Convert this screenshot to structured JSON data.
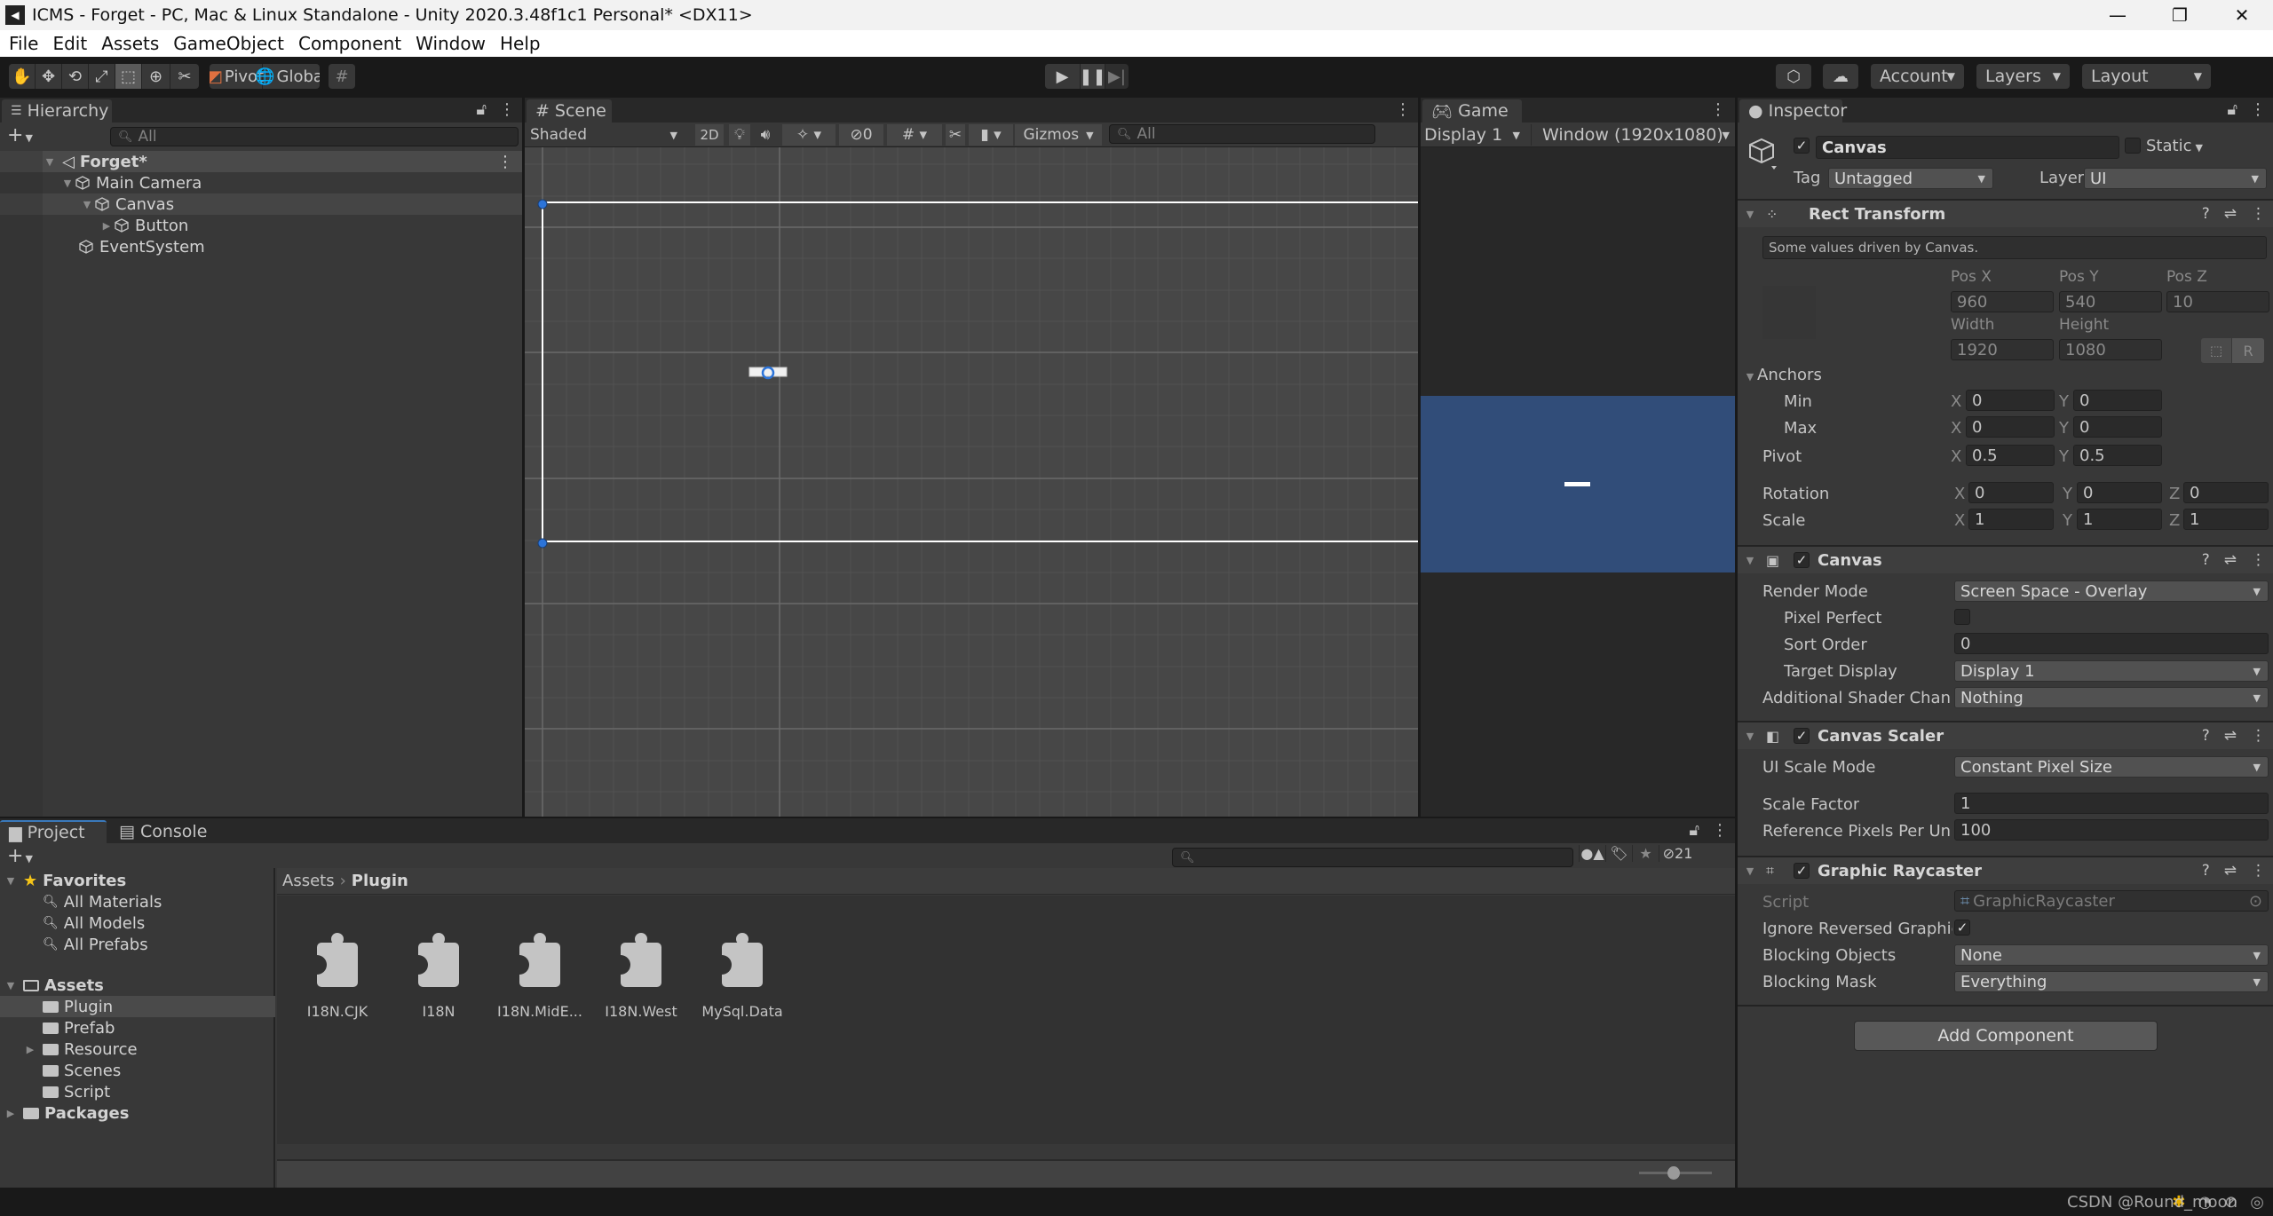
{
  "window": {
    "title": "ICMS - Forget - PC, Mac & Linux Standalone - Unity 2020.3.48f1c1 Personal* <DX11>",
    "controls": {
      "minimize": "—",
      "maximize": "❐",
      "close": "✕"
    }
  },
  "menu": [
    "File",
    "Edit",
    "Assets",
    "GameObject",
    "Component",
    "Window",
    "Help"
  ],
  "toolbar": {
    "tools": [
      "hand-tool",
      "move-tool",
      "rotate-tool",
      "scale-tool",
      "rect-tool",
      "transform-tool",
      "custom-tool"
    ],
    "active_tool": "rect-tool",
    "pivot_label": "Pivot",
    "global_label": "Global",
    "account_label": "Account",
    "layers_label": "Layers",
    "layout_label": "Layout"
  },
  "hierarchy": {
    "tab_label": "Hierarchy",
    "search_placeholder": "All",
    "scene_name": "Forget*",
    "items": [
      {
        "label": "Main Camera",
        "depth": 1,
        "expanded": true
      },
      {
        "label": "Canvas",
        "depth": 2,
        "expanded": true,
        "selected": true
      },
      {
        "label": "Button",
        "depth": 3,
        "expanded": false
      },
      {
        "label": "EventSystem",
        "depth": 1
      }
    ]
  },
  "scene": {
    "tab_label": "Scene",
    "shading_mode": "Shaded",
    "mode_2d": "2D",
    "hidden_count": "0",
    "gizmos_label": "Gizmos",
    "search_placeholder": "All"
  },
  "game": {
    "tab_label": "Game",
    "display": "Display 1",
    "resolution": "Window (1920x1080)",
    "background_color": "#314d79"
  },
  "inspector": {
    "tab_label": "Inspector",
    "object_name": "Canvas",
    "active": true,
    "static_label": "Static",
    "tag_label": "Tag",
    "tag_value": "Untagged",
    "layer_label": "Layer",
    "layer_value": "UI",
    "rect_transform": {
      "title": "Rect Transform",
      "note": "Some values driven by Canvas.",
      "pos_x_label": "Pos X",
      "pos_y_label": "Pos Y",
      "pos_z_label": "Pos Z",
      "pos_x": "960",
      "pos_y": "540",
      "pos_z": "10",
      "width_label": "Width",
      "height_label": "Height",
      "width": "1920",
      "height": "1080",
      "raw_label": "R",
      "anchors_label": "Anchors",
      "min_label": "Min",
      "max_label": "Max",
      "anchor_min_x": "0",
      "anchor_min_y": "0",
      "anchor_max_x": "0",
      "anchor_max_y": "0",
      "pivot_label": "Pivot",
      "pivot_x": "0.5",
      "pivot_y": "0.5",
      "rotation_label": "Rotation",
      "rot_x": "0",
      "rot_y": "0",
      "rot_z": "0",
      "scale_label": "Scale",
      "scale_x": "1",
      "scale_y": "1",
      "scale_z": "1",
      "x": "X",
      "y": "Y",
      "z": "Z"
    },
    "canvas": {
      "title": "Canvas",
      "enabled": true,
      "render_mode_label": "Render Mode",
      "render_mode": "Screen Space - Overlay",
      "pixel_perfect_label": "Pixel Perfect",
      "pixel_perfect": false,
      "sort_order_label": "Sort Order",
      "sort_order": "0",
      "target_display_label": "Target Display",
      "target_display": "Display 1",
      "shader_channels_label": "Additional Shader Chan",
      "shader_channels": "Nothing"
    },
    "canvas_scaler": {
      "title": "Canvas Scaler",
      "enabled": true,
      "scale_mode_label": "UI Scale Mode",
      "scale_mode": "Constant Pixel Size",
      "scale_factor_label": "Scale Factor",
      "scale_factor": "1",
      "ref_pixels_label": "Reference Pixels Per Un",
      "ref_pixels": "100"
    },
    "graphic_raycaster": {
      "title": "Graphic Raycaster",
      "enabled": true,
      "script_label": "Script",
      "script": "GraphicRaycaster",
      "ignore_reversed_label": "Ignore Reversed Graphic",
      "ignore_reversed": true,
      "blocking_objects_label": "Blocking Objects",
      "blocking_objects": "None",
      "blocking_mask_label": "Blocking Mask",
      "blocking_mask": "Everything"
    },
    "add_component_label": "Add Component"
  },
  "project": {
    "tab_label": "Project",
    "console_tab_label": "Console",
    "hidden_count": "21",
    "favorites_label": "Favorites",
    "favorites": [
      "All Materials",
      "All Models",
      "All Prefabs"
    ],
    "assets_label": "Assets",
    "asset_folders": [
      {
        "label": "Plugin",
        "selected": true,
        "has_children": false
      },
      {
        "label": "Prefab",
        "has_children": false
      },
      {
        "label": "Resource",
        "has_children": true
      },
      {
        "label": "Scenes",
        "has_children": false
      },
      {
        "label": "Script",
        "has_children": false
      }
    ],
    "packages_label": "Packages",
    "breadcrumb": [
      "Assets",
      "Plugin"
    ],
    "files": [
      "I18N.CJK",
      "I18N",
      "I18N.MidE...",
      "I18N.West",
      "MySql.Data"
    ],
    "zoom_slider": 0.4
  },
  "status_bar": {
    "watermark": "CSDN @Round_moon"
  }
}
